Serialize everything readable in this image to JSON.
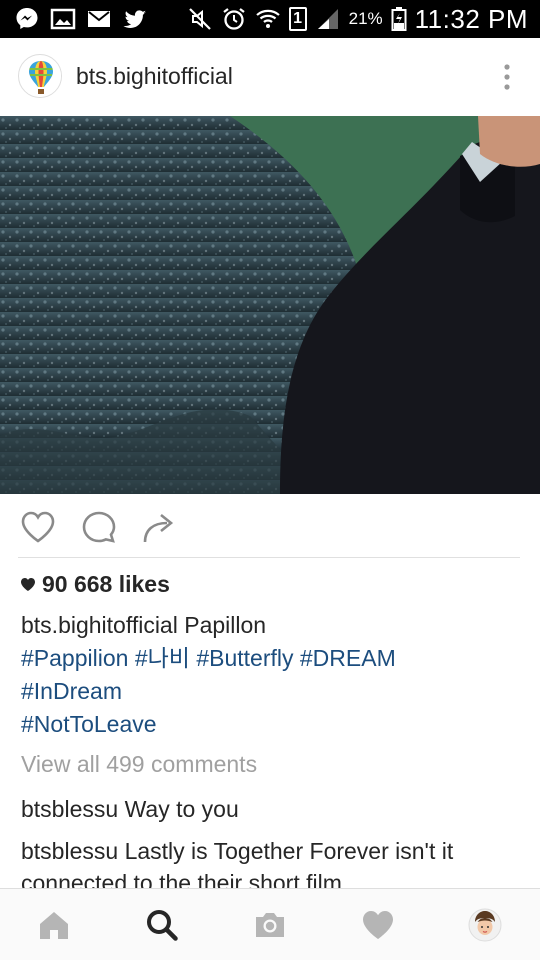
{
  "status_bar": {
    "battery_percent": "21%",
    "time": "11:32 PM",
    "sim_slot": "1",
    "icons": [
      "messenger-icon",
      "gallery-icon",
      "mail-icon",
      "twitter-icon",
      "mute-icon",
      "alarm-icon",
      "wifi-icon",
      "sim-icon",
      "signal-icon",
      "battery-icon"
    ]
  },
  "post": {
    "username": "bts.bighitofficial",
    "likes": "90 668 likes",
    "caption_user": "bts.bighitofficial",
    "caption_text": "Papillon",
    "hashtags_line1": [
      "#Pappilion",
      "#나비",
      "#Butterfly",
      "#DREAM"
    ],
    "hashtags_line2": "#InDream",
    "hashtags_line3": "#NotToLeave",
    "view_all_comments": "View all 499 comments",
    "comments": [
      {
        "user": "btsblessu",
        "text": "Way to you"
      },
      {
        "user": "btsblessu",
        "text": "Lastly is Together Forever isn't it connected to the their short film"
      }
    ]
  },
  "actions": [
    "heart-icon",
    "comment-icon",
    "share-icon"
  ],
  "bottom_nav": [
    "home-icon",
    "search-icon",
    "camera-icon",
    "activity-heart-icon",
    "profile-avatar"
  ],
  "colors": {
    "hashtag": "#1c4d7e",
    "muted": "#a0a0a0",
    "text": "#262626",
    "status_bar_bg": "#000000"
  }
}
